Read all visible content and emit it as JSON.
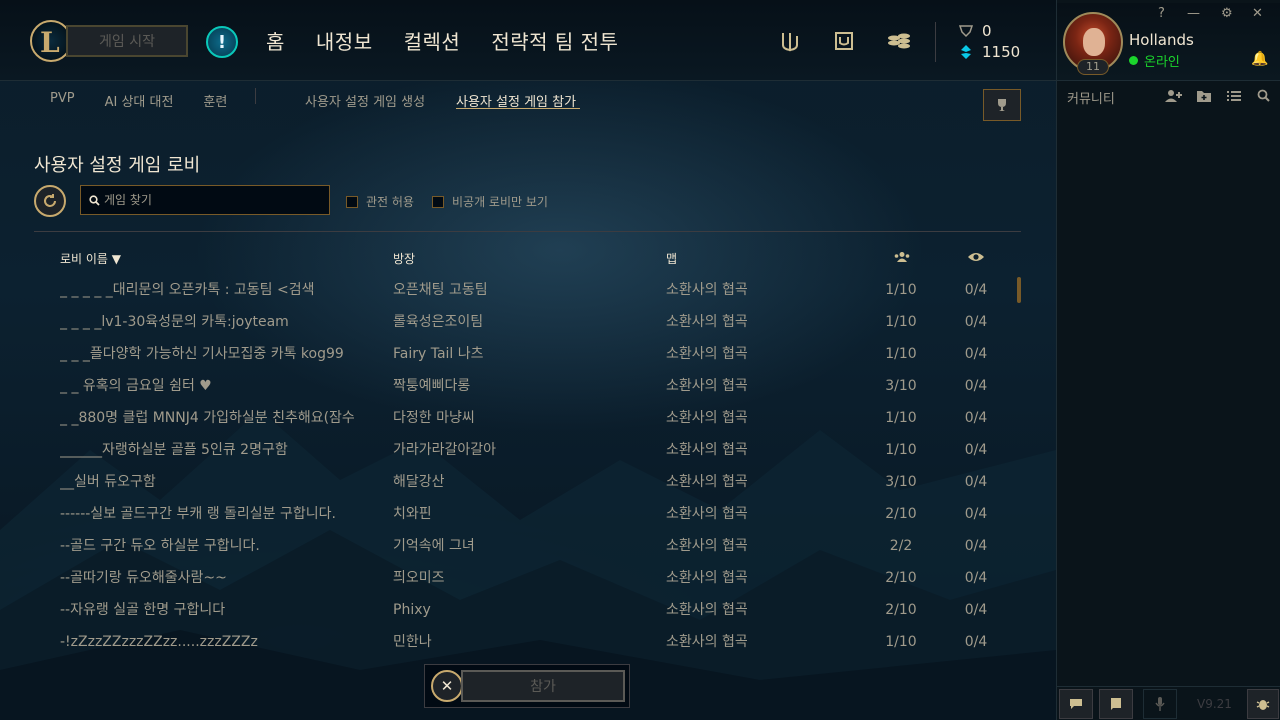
{
  "topbar": {
    "play_label": "게임 시작",
    "alert_glyph": "!",
    "nav": [
      "홈",
      "내정보",
      "컬렉션",
      "전략적 팀 전투"
    ],
    "currency": {
      "rp": "0",
      "be": "1150"
    }
  },
  "window": {
    "help": "?",
    "minimize": "—",
    "settings": "⚙",
    "close": "✕"
  },
  "profile": {
    "name": "Hollands",
    "status": "온라인",
    "level": "11"
  },
  "social": {
    "community_label": "커뮤니티",
    "version": "V9.21"
  },
  "subnav": {
    "items": [
      "PVP",
      "AI 상대 대전",
      "훈련"
    ],
    "create": "사용자 설정 게임 생성",
    "join": "사용자 설정 게임 참가"
  },
  "lobby": {
    "title": "사용자 설정 게임 로비",
    "search_placeholder": "게임 찾기",
    "allow_spectate": "관전 허용",
    "private_only": "비공개 로비만 보기",
    "headers": {
      "name": "로비 이름 ▼",
      "host": "방장",
      "map": "맵"
    },
    "rows": [
      {
        "name": "_ _ _ _ _대리문의 오픈카톡 : 고동팀 <검색",
        "host": "오픈채팅 고동팀",
        "map": "소환사의 협곡",
        "players": "1/10",
        "spectators": "0/4"
      },
      {
        "name": "_ _ _ _lv1-30육성문의 카톡:joyteam",
        "host": "롤육성은조이팀",
        "map": "소환사의 협곡",
        "players": "1/10",
        "spectators": "0/4"
      },
      {
        "name": "_ _ _플다양학 가능하신 기사모집중 카톡 kog99",
        "host": "Fairy Tail 나츠",
        "map": "소환사의 협곡",
        "players": "1/10",
        "spectators": "0/4"
      },
      {
        "name": "_ _ 유혹의 금요일 쉼터 ♥",
        "host": "짝퉁예삐다롱",
        "map": "소환사의 협곡",
        "players": "3/10",
        "spectators": "0/4"
      },
      {
        "name": "_ _880명 클럽 MNNJ4 가입하실분 친추해요(잠수",
        "host": "다정한 마냥씨",
        "map": "소환사의 협곡",
        "players": "1/10",
        "spectators": "0/4"
      },
      {
        "name": "______자랭하실분 골플 5인큐 2명구함",
        "host": "가라가라갈아갈아",
        "map": "소환사의 협곡",
        "players": "1/10",
        "spectators": "0/4"
      },
      {
        "name": "__실버 듀오구함",
        "host": "해달강산",
        "map": "소환사의 협곡",
        "players": "3/10",
        "spectators": "0/4"
      },
      {
        "name": "------실보 골드구간 부캐 랭 돌리실분 구합니다.",
        "host": "치와핀",
        "map": "소환사의 협곡",
        "players": "2/10",
        "spectators": "0/4"
      },
      {
        "name": "--골드 구간 듀오 하실분 구합니다.",
        "host": "기억속에 그녀",
        "map": "소환사의 협곡",
        "players": "2/2",
        "spectators": "0/4"
      },
      {
        "name": "--골따기랑 듀오해줄사람~~",
        "host": "픠오미즈",
        "map": "소환사의 협곡",
        "players": "2/10",
        "spectators": "0/4"
      },
      {
        "name": "--자유랭 실골 한명 구합니다",
        "host": "Phixy",
        "map": "소환사의 협곡",
        "players": "2/10",
        "spectators": "0/4"
      },
      {
        "name": "-!zZzzZZzzzZZzz.....zzzZZZz",
        "host": "민한나",
        "map": "소환사의 협곡",
        "players": "1/10",
        "spectators": "0/4"
      }
    ]
  },
  "footer": {
    "cancel_glyph": "✕",
    "join_label": "참가"
  }
}
